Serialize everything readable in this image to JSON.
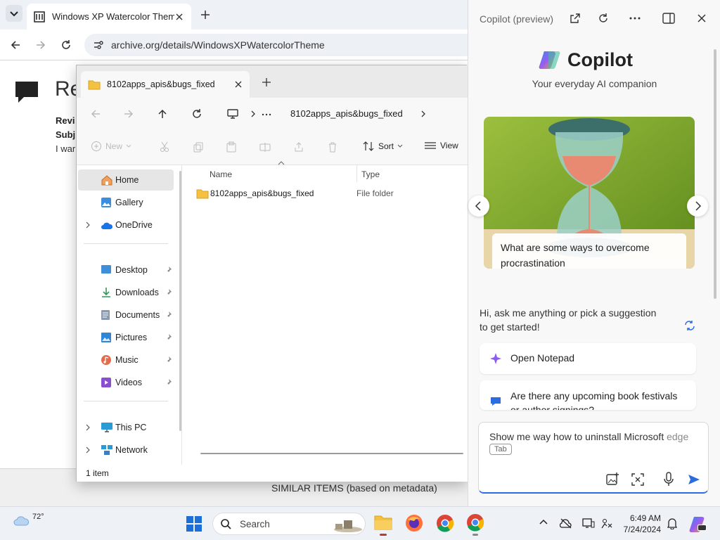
{
  "browser": {
    "tab_title": "Windows XP Watercolor Theme",
    "url": "archive.org/details/WindowsXPWatercolorTheme"
  },
  "page": {
    "heading": "Re",
    "line1": "Revi",
    "line2": "Subj",
    "line3": "I war",
    "similar": "SIMILAR ITEMS (based on metadata)"
  },
  "explorer": {
    "tab_title": "8102apps_apis&bugs_fixed",
    "path": "8102apps_apis&bugs_fixed",
    "toolbar": {
      "new": "New",
      "sort": "Sort",
      "view": "View"
    },
    "columns": {
      "name": "Name",
      "type": "Type"
    },
    "files": [
      {
        "name": "8102apps_apis&bugs_fixed",
        "type": "File folder"
      }
    ],
    "nav": {
      "home": "Home",
      "gallery": "Gallery",
      "onedrive": "OneDrive",
      "desktop": "Desktop",
      "downloads": "Downloads",
      "documents": "Documents",
      "pictures": "Pictures",
      "music": "Music",
      "videos": "Videos",
      "thispc": "This PC",
      "network": "Network"
    },
    "status": "1 item"
  },
  "copilot": {
    "header_title": "Copilot (preview)",
    "brand": "Copilot",
    "tagline": "Your everyday AI companion",
    "card_caption": "What are some ways to overcome procrastination",
    "greeting_line1": "Hi, ask me anything or pick a suggestion",
    "greeting_line2": "to get started!",
    "suggestion1": "Open Notepad",
    "suggestion2_line1": "Are there any upcoming book festivals",
    "suggestion2_line2": "or author signings?",
    "input_text": "Show me way how to uninstall Microsoft",
    "input_hint": "edge",
    "tab_key": "Tab"
  },
  "taskbar": {
    "weather": "72°",
    "search_placeholder": "Search",
    "time": "6:49 AM",
    "date": "7/24/2024"
  },
  "colors": {
    "accent": "#2b6de0",
    "folder": "#f5c142",
    "taskbar": "#eef1f6",
    "copilot_bg": "#f8f8f8"
  }
}
